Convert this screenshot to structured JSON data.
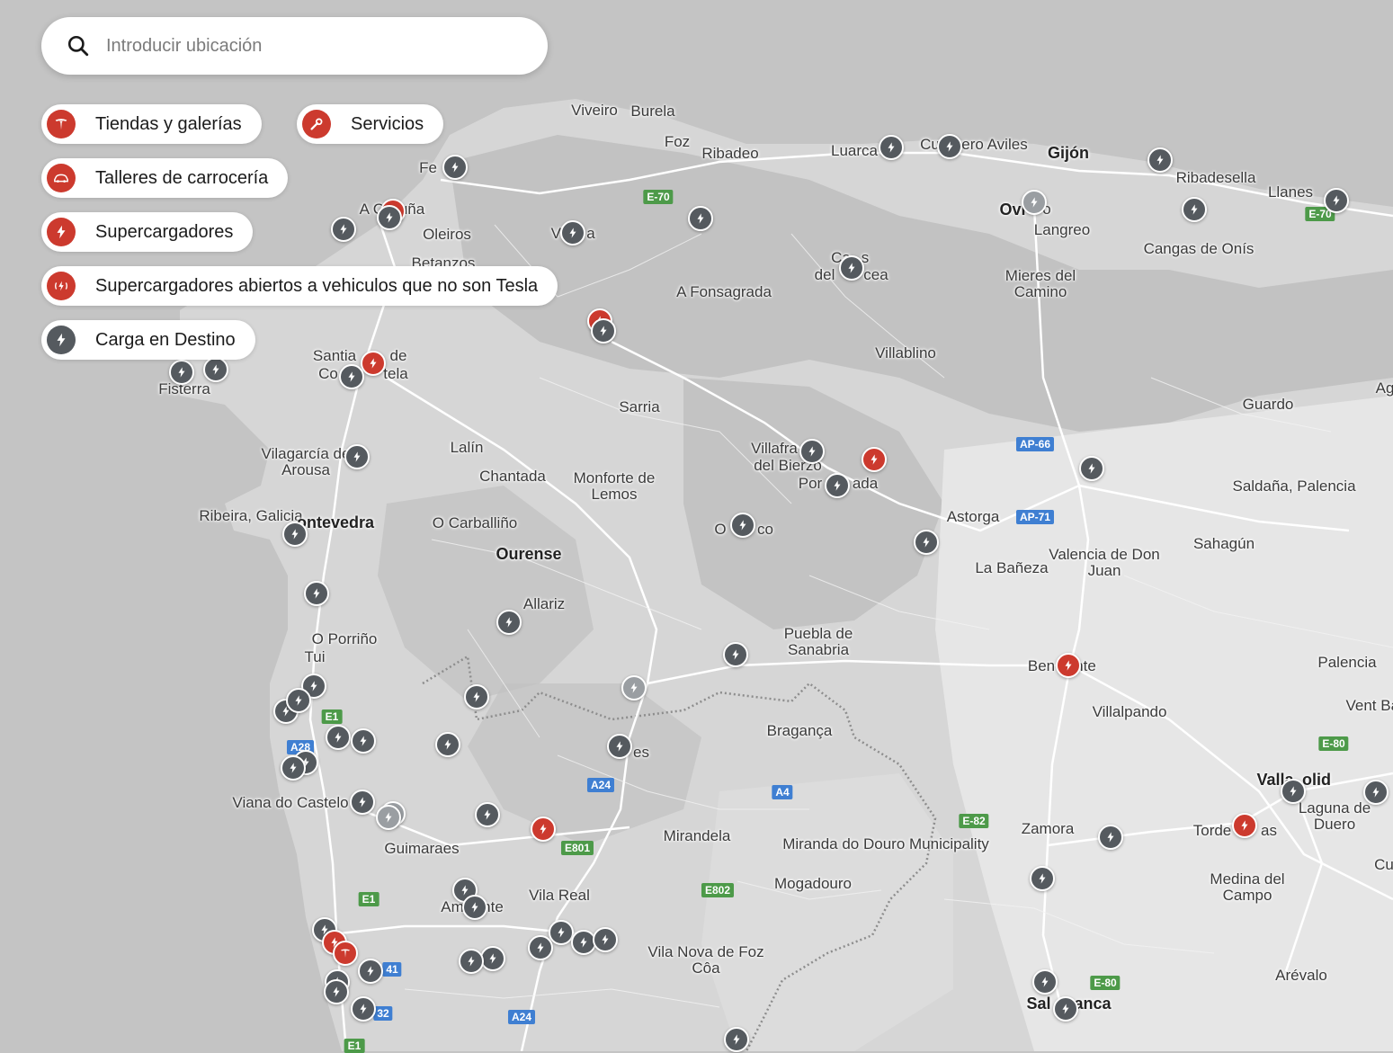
{
  "search": {
    "placeholder": "Introducir ubicación"
  },
  "filters": [
    {
      "label": "Tiendas y galerías",
      "icon": "tesla-logo-icon",
      "color": "#cc3a2e"
    },
    {
      "label": "Servicios",
      "icon": "wrench-icon",
      "color": "#cc3a2e"
    },
    {
      "label": "Talleres de carrocería",
      "icon": "car-icon",
      "color": "#cc3a2e"
    },
    {
      "label": "Supercargadores",
      "icon": "bolt-icon",
      "color": "#cc3a2e"
    },
    {
      "label": "Supercargadores abiertos a vehiculos que no son Tesla",
      "icon": "bolt-signal-icon",
      "color": "#cc3a2e"
    },
    {
      "label": "Carga en Destino",
      "icon": "bolt-icon",
      "color": "#555a5f"
    }
  ],
  "places": [
    "Viveiro",
    "Burela",
    "Foz",
    "Ribadeo",
    "Luarca",
    "Cu",
    "ero Aviles",
    "Gijón",
    "Ribadesella",
    "Llanes",
    "Fe",
    "A Co",
    "uña",
    "Oleiros",
    "Betanzos",
    "Vi",
    "a",
    "Ovi",
    "o",
    "Langreo",
    "Ca",
    "s",
    "del",
    "cea",
    "Cangas de Onís",
    "Mieres del Camino",
    "A Fonsagrada",
    "Villablino",
    "Santia",
    "de",
    "Co",
    "tela",
    "Fisterra",
    "Sarria",
    "Guardo",
    "Lalín",
    "Chantada",
    "Villafra",
    "del Bierzo",
    "Por",
    "ada",
    "Vilagarcía de Arousa",
    "Monforte de Lemos",
    "Ribeira, Galicia",
    "ontevedra",
    "O Carballiño",
    "O",
    "co",
    "Astorga",
    "Saldaña, Palencia",
    "La Bañeza",
    "Valencia de Don Juan",
    "Sahagún",
    "Ourense",
    "Allariz",
    "O Porriño",
    "Tui",
    "Puebla de Sanabria",
    "Ben",
    "nte",
    "Palencia",
    "Villalpando",
    "Bragança",
    "es",
    "Viana do Castelo",
    "Guimaraes",
    "Mirandela",
    "Miranda do Douro Municipality",
    "Zamora",
    "Torde",
    "as",
    "Valla",
    "olid",
    "Laguna de Duero",
    "Vila Real",
    "Am",
    "nte",
    "Mogadouro",
    "Medina del Campo",
    "Vila Nova de Foz Côa",
    "Arévalo",
    "Sal",
    "anca",
    "Vent Bañ",
    "Ag",
    "Cu"
  ],
  "roads": [
    "E-70",
    "E-70",
    "AP-66",
    "AP-71",
    "E1",
    "A28",
    "A24",
    "E801",
    "A4",
    "E-82",
    "E-80",
    "E802",
    "E1",
    "A24",
    "E-80",
    "41",
    "32",
    "E1"
  ]
}
